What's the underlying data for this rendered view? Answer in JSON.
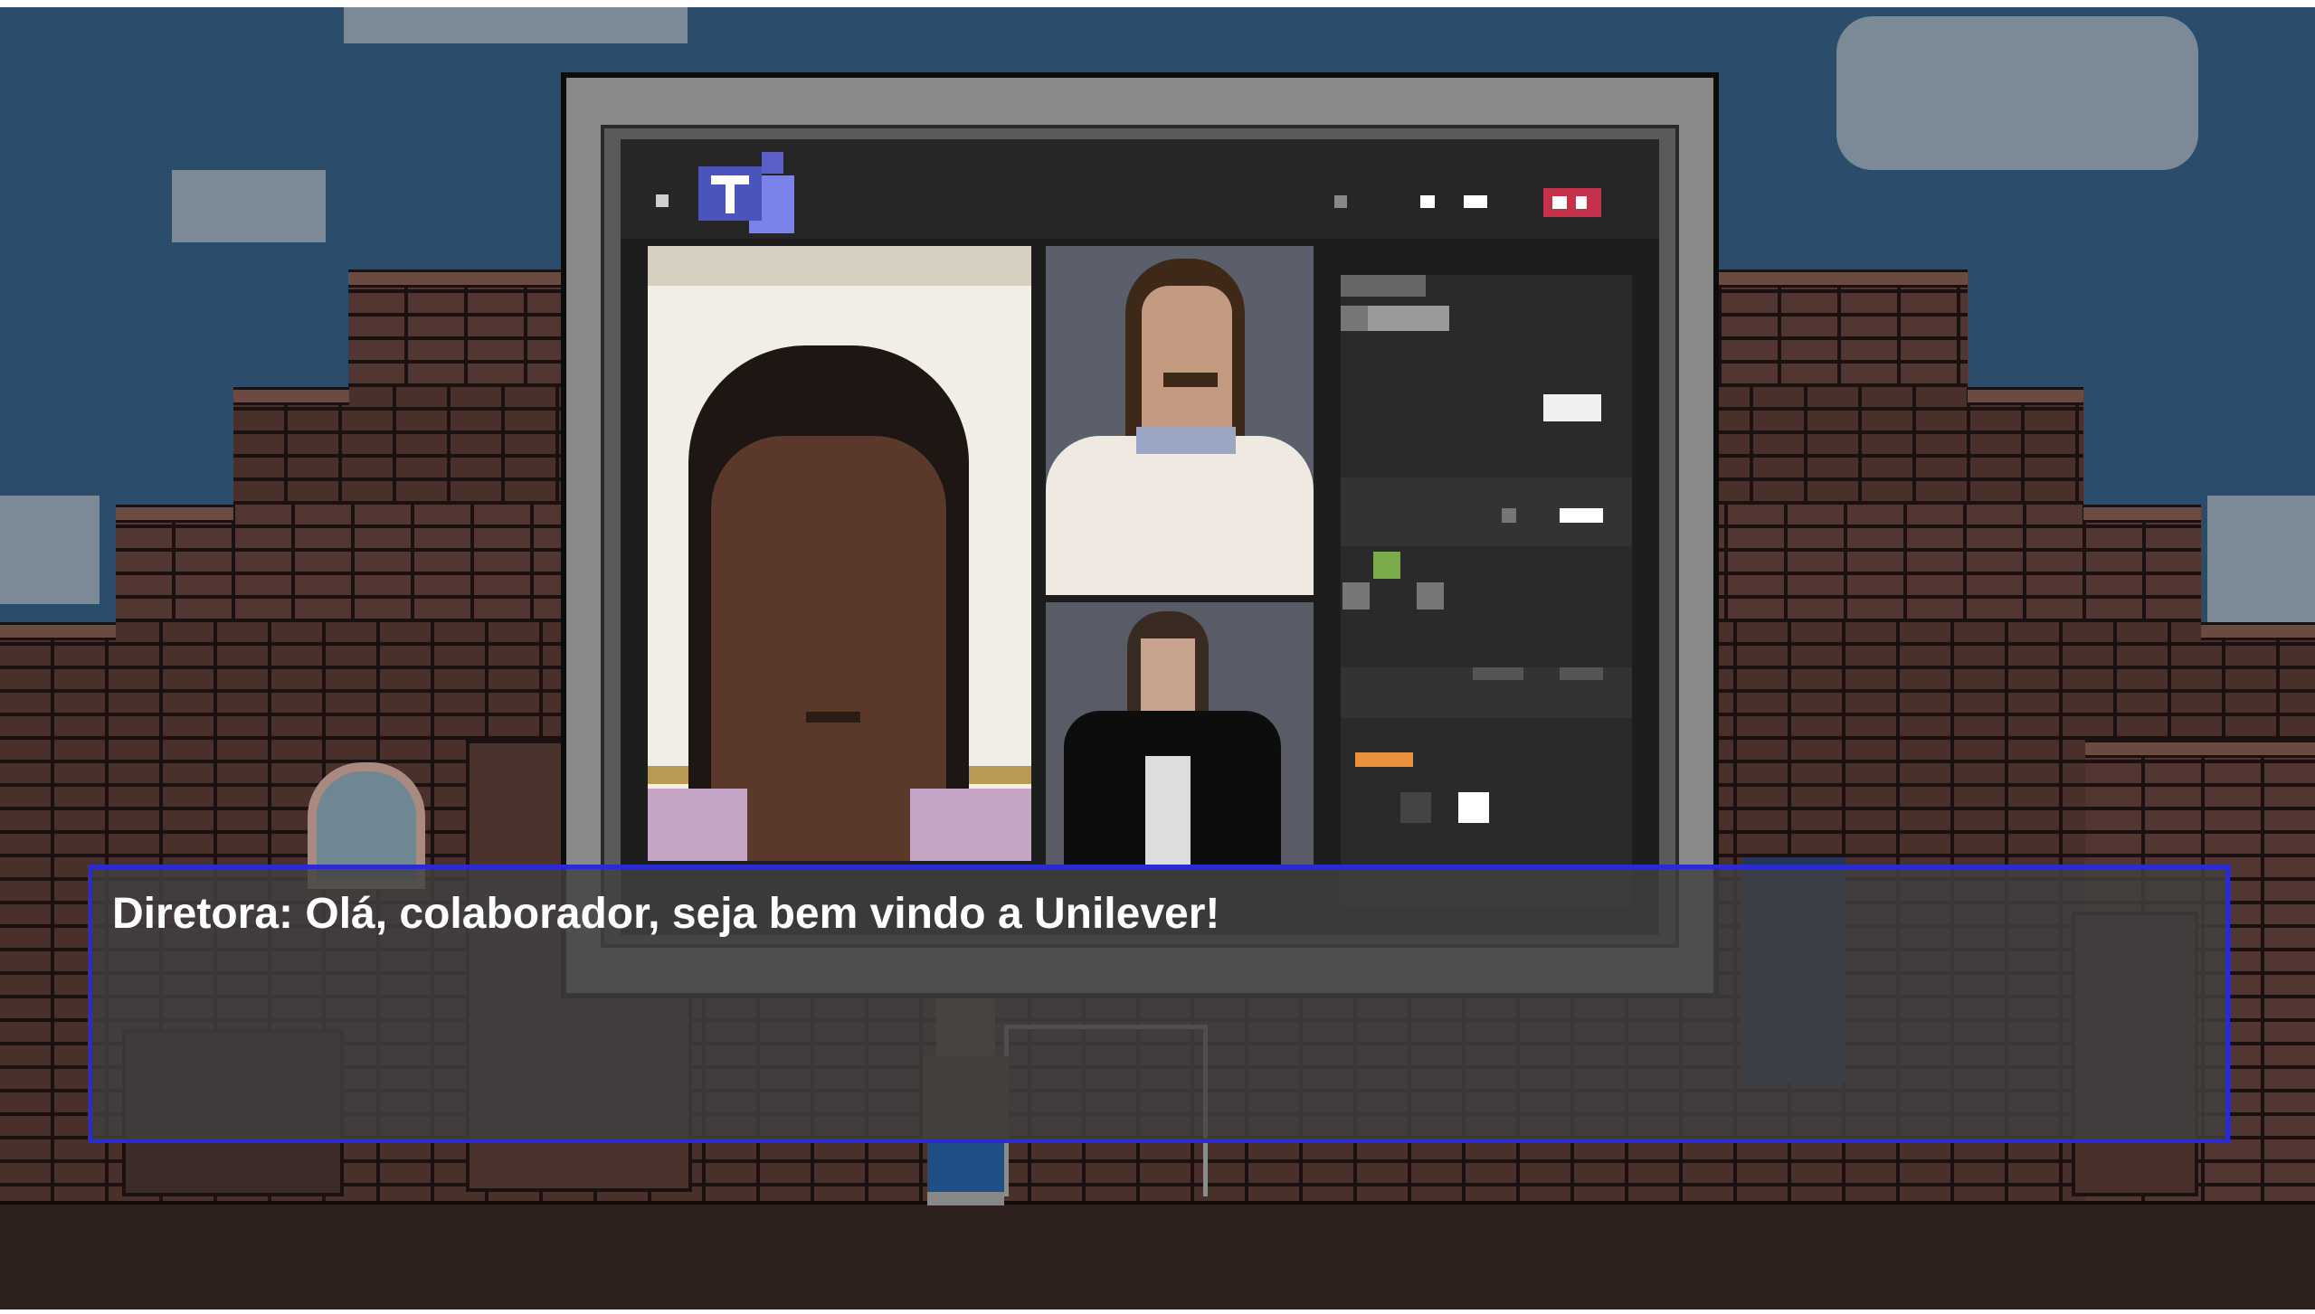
{
  "dialog": {
    "text": "Diretora: Olá, colaborador, seja bem vindo a Unilever!"
  },
  "icons": [
    "teams-logo-icon",
    "window-close-icon"
  ],
  "colors": {
    "sky": "#2c4c6c",
    "brick": "#3a2a26",
    "dialog_border": "#2a2bd0",
    "dialog_background": "#414141",
    "teams_purple": "#5b5fc7",
    "close_button": "#c4314b"
  }
}
